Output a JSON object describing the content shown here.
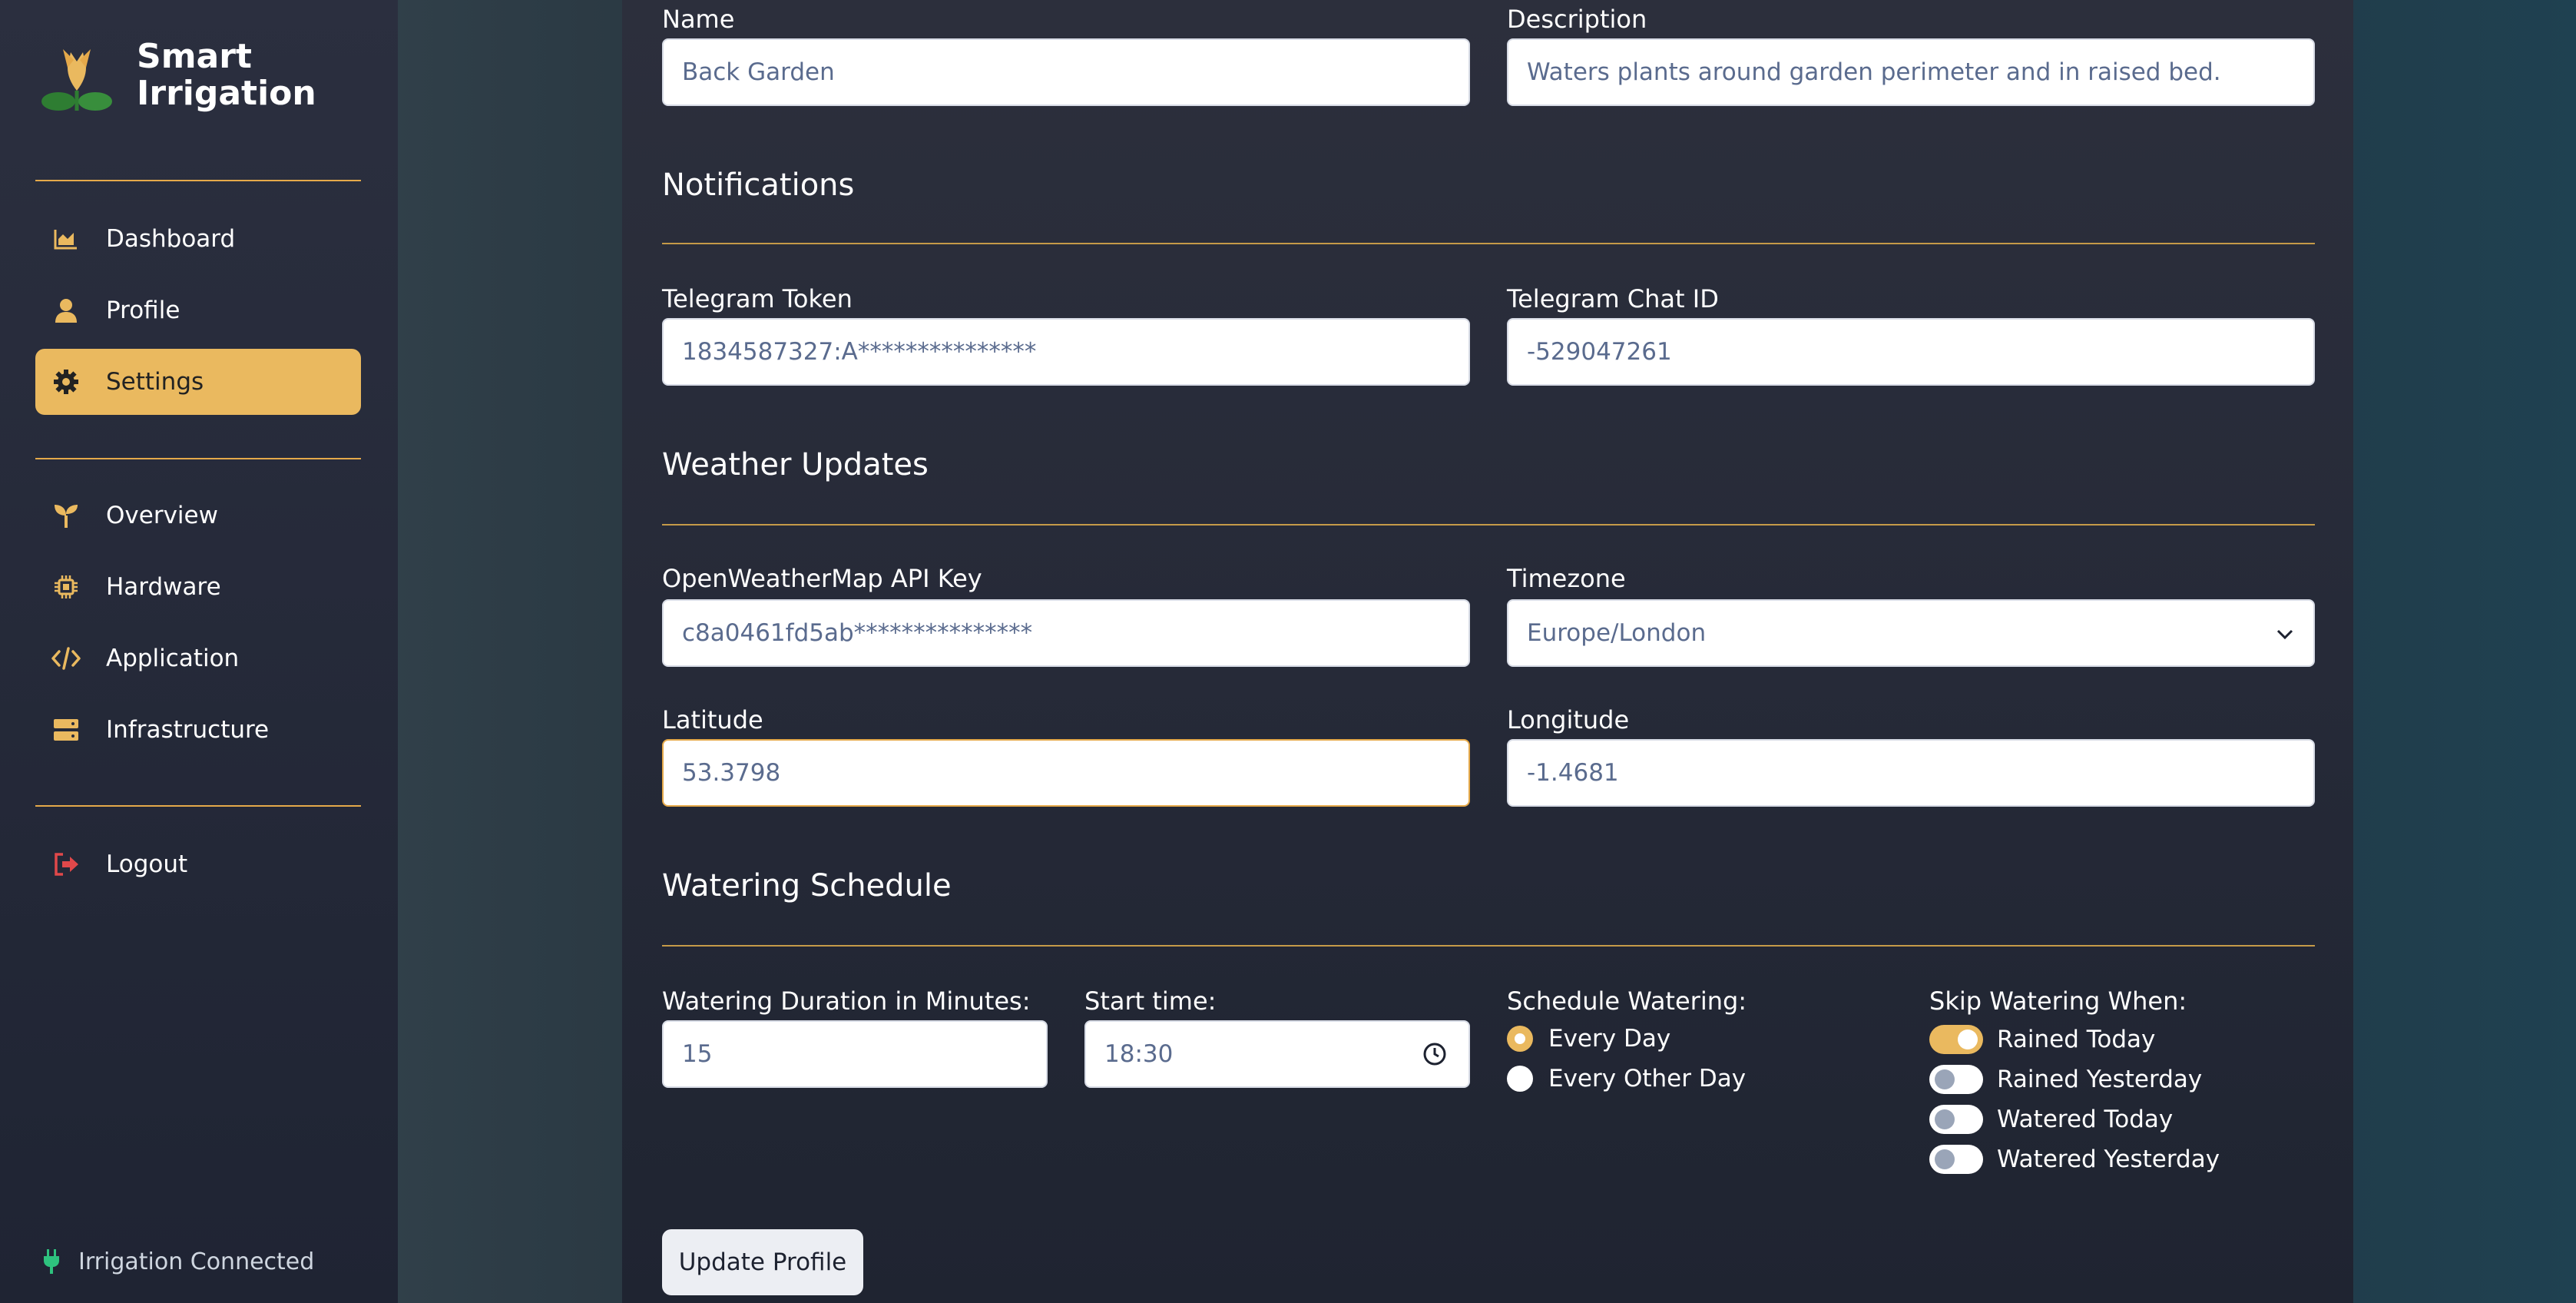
{
  "app": {
    "title_line1": "Smart",
    "title_line2": "Irrigation",
    "status_text": "Irrigation Connected"
  },
  "sidebar": {
    "group1": [
      {
        "label": "Dashboard",
        "icon": "chart-area-icon"
      },
      {
        "label": "Profile",
        "icon": "user-icon"
      },
      {
        "label": "Settings",
        "icon": "gear-icon",
        "active": true
      }
    ],
    "group2": [
      {
        "label": "Overview",
        "icon": "seedling-icon"
      },
      {
        "label": "Hardware",
        "icon": "microchip-icon"
      },
      {
        "label": "Application",
        "icon": "code-icon"
      },
      {
        "label": "Infrastructure",
        "icon": "server-icon"
      }
    ],
    "group3": [
      {
        "label": "Logout",
        "icon": "logout-icon"
      }
    ]
  },
  "form": {
    "name_label": "Name",
    "name_value": "Back Garden",
    "description_label": "Description",
    "description_value": "Waters plants around garden perimeter and in raised bed.",
    "notifications_title": "Notifications",
    "telegram_token_label": "Telegram Token",
    "telegram_token_value": "1834587327:A***************",
    "telegram_chat_label": "Telegram Chat ID",
    "telegram_chat_value": "-529047261",
    "weather_title": "Weather Updates",
    "owm_label": "OpenWeatherMap API Key",
    "owm_value": "c8a0461fd5ab***************",
    "timezone_label": "Timezone",
    "timezone_value": "Europe/London",
    "latitude_label": "Latitude",
    "latitude_value": "53.3798",
    "longitude_label": "Longitude",
    "longitude_value": "-1.4681",
    "schedule_title": "Watering Schedule",
    "duration_label": "Watering Duration in Minutes:",
    "duration_value": "15",
    "start_label": "Start time:",
    "start_value": "18:30",
    "schedule_label": "Schedule Watering:",
    "schedule_options": [
      {
        "label": "Every Day",
        "selected": true
      },
      {
        "label": "Every Other Day",
        "selected": false
      }
    ],
    "skip_label": "Skip Watering When:",
    "skip_options": [
      {
        "label": "Rained Today",
        "on": true
      },
      {
        "label": "Rained Yesterday",
        "on": false
      },
      {
        "label": "Watered Today",
        "on": false
      },
      {
        "label": "Watered Yesterday",
        "on": false
      }
    ],
    "submit_label": "Update Profile"
  },
  "colors": {
    "accent": "#eab95f",
    "sidebar_bg": "#262a3a",
    "panel_bg": "#282c3a",
    "logout_red": "#e0484a",
    "status_green": "#2ec27e"
  }
}
